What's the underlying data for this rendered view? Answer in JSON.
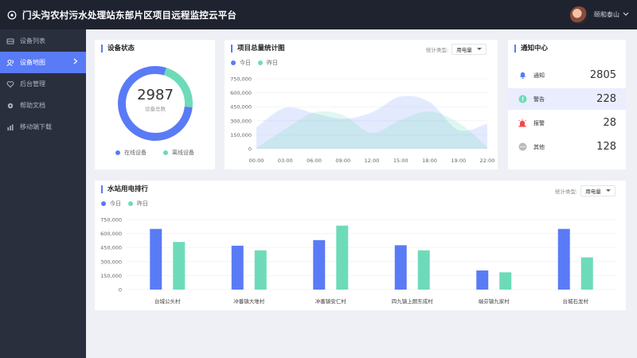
{
  "header": {
    "title": "门头沟农村污水处理站东部片区项目远程监控云平台",
    "username": "颐和泰山"
  },
  "sidebar": {
    "items": [
      {
        "label": "设备列表",
        "icon": "device-list-icon",
        "active": false
      },
      {
        "label": "设备地图",
        "icon": "users-icon",
        "active": true
      },
      {
        "label": "后台管理",
        "icon": "heart-icon",
        "active": false
      },
      {
        "label": "帮助文档",
        "icon": "settings-icon",
        "active": false
      },
      {
        "label": "移动端下载",
        "icon": "bar-chart-icon",
        "active": false
      }
    ]
  },
  "device_status": {
    "title": "设备状态",
    "total": "2987",
    "total_label": "设备总数",
    "legend_online": "在线设备",
    "legend_offline": "离线设备",
    "colors": {
      "online": "#5a7bf6",
      "offline": "#6ddbb9"
    }
  },
  "project_chart": {
    "title": "项目总量统计图",
    "select_label": "统计类型:",
    "select_value": "用电量",
    "legend_today": "今日",
    "legend_yesterday": "昨日"
  },
  "notifications": {
    "title": "通知中心",
    "items": [
      {
        "label": "通知",
        "count": "2805",
        "icon": "bell-icon",
        "color": "#5a7bf6"
      },
      {
        "label": "警告",
        "count": "228",
        "icon": "exclamation-icon",
        "color": "#6ddbb9"
      },
      {
        "label": "报警",
        "count": "28",
        "icon": "alarm-icon",
        "color": "#f5474a"
      },
      {
        "label": "其他",
        "count": "128",
        "icon": "more-icon",
        "color": "#aaaaaa"
      }
    ]
  },
  "station_chart": {
    "title": "水站用电排行",
    "select_label": "统计类型:",
    "select_value": "用电量",
    "legend_today": "今日",
    "legend_yesterday": "昨日"
  },
  "chart_data": [
    {
      "type": "pie",
      "values": [
        0.78,
        0.22
      ],
      "categories": [
        "在线设备",
        "离线设备"
      ],
      "colors": [
        "#5a7bf6",
        "#6ddbb9"
      ]
    },
    {
      "type": "area",
      "x": [
        "00:00",
        "03:00",
        "06:00",
        "09:00",
        "12:00",
        "15:00",
        "18:00",
        "19:00",
        "22:00"
      ],
      "ylim": [
        0,
        750000
      ],
      "yticks": [
        "750,000",
        "600,000",
        "450,000",
        "300,000",
        "150,000",
        "0"
      ],
      "series": [
        {
          "name": "今日",
          "values": [
            230000,
            440000,
            380000,
            320000,
            390000,
            560000,
            500000,
            200000,
            270000
          ],
          "color": "#5a7bf6"
        },
        {
          "name": "昨日",
          "values": [
            10000,
            210000,
            390000,
            360000,
            170000,
            310000,
            400000,
            280000,
            20000
          ],
          "color": "#6ddbb9"
        }
      ],
      "grid": true
    },
    {
      "type": "bar",
      "categories": [
        "台城公头村",
        "冲番镇大堆村",
        "冲番镇安仁村",
        "四九镇上朗东成村",
        "端芬镇九家村",
        "台城石龙村"
      ],
      "ylim": [
        0,
        750000
      ],
      "yticks": [
        "750,000",
        "600,000",
        "450,000",
        "300,000",
        "150,000",
        "0"
      ],
      "series": [
        {
          "name": "今日",
          "values": [
            650000,
            470000,
            530000,
            475000,
            205000,
            650000
          ],
          "color": "#5a7bf6"
        },
        {
          "name": "昨日",
          "values": [
            510000,
            420000,
            685000,
            420000,
            185000,
            345000
          ],
          "color": "#6ddbb9"
        }
      ],
      "grid": true
    }
  ]
}
